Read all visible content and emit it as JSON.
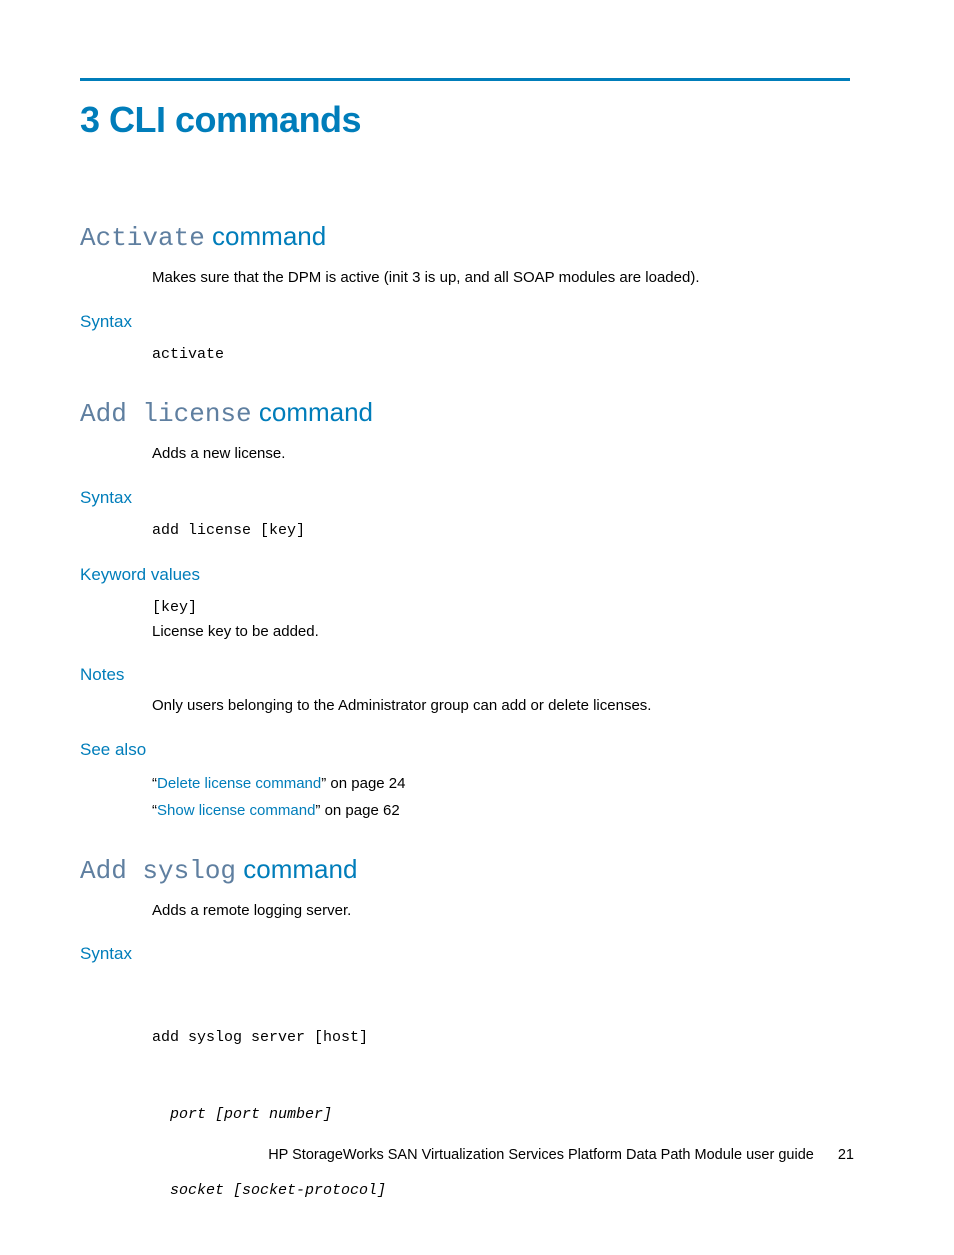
{
  "chapter": {
    "title": "3 CLI commands"
  },
  "sections": {
    "activate": {
      "heading_mono": "Activate",
      "heading_rest": " command",
      "desc": "Makes sure that the DPM is active (init 3 is up, and all SOAP modules are loaded).",
      "syntax_label": "Syntax",
      "syntax_code": "activate"
    },
    "addlicense": {
      "heading_mono": "Add license",
      "heading_rest": " command",
      "desc": "Adds a new license.",
      "syntax_label": "Syntax",
      "syntax_code": "add license [key]",
      "kv_label": "Keyword values",
      "kv_code": "[key]",
      "kv_desc": "License key to be added.",
      "notes_label": "Notes",
      "notes_text": "Only users belonging to the Administrator group can add or delete licenses.",
      "seealso_label": "See also",
      "seealso": [
        {
          "open": "“",
          "link": "Delete license command",
          "close": "” on page 24"
        },
        {
          "open": "“",
          "link": "Show license command",
          "close": "” on page 62"
        }
      ]
    },
    "addsyslog": {
      "heading_mono": "Add syslog",
      "heading_rest": " command",
      "desc": "Adds a remote logging server.",
      "syntax_label": "Syntax",
      "syntax_line1": "add syslog server [host]",
      "syntax_line2": "  port [port number]",
      "syntax_line3": "  socket [socket-protocol]"
    }
  },
  "footer": {
    "text": "HP StorageWorks SAN Virtualization Services Platform Data Path Module user guide",
    "page": "21"
  }
}
